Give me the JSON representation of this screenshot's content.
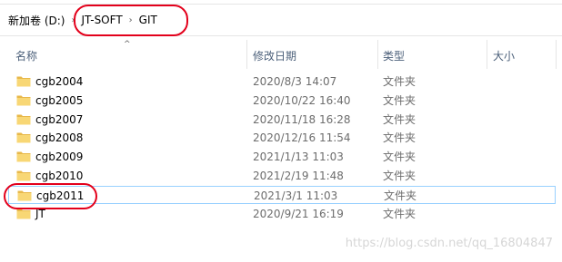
{
  "breadcrumb": {
    "items": [
      "新加卷 (D:)",
      "JT-SOFT",
      "GIT"
    ]
  },
  "columns": {
    "name": "名称",
    "date": "修改日期",
    "type": "类型",
    "size": "大小"
  },
  "files": [
    {
      "name": "cgb2004",
      "date": "2020/8/3 14:07",
      "type": "文件夹",
      "icon": "folder-icon"
    },
    {
      "name": "cgb2005",
      "date": "2020/10/22 16:40",
      "type": "文件夹",
      "icon": "folder-icon"
    },
    {
      "name": "cgb2007",
      "date": "2020/11/18 16:28",
      "type": "文件夹",
      "icon": "folder-icon"
    },
    {
      "name": "cgb2008",
      "date": "2020/12/16 11:54",
      "type": "文件夹",
      "icon": "folder-icon"
    },
    {
      "name": "cgb2009",
      "date": "2021/1/13 11:03",
      "type": "文件夹",
      "icon": "folder-icon"
    },
    {
      "name": "cgb2010",
      "date": "2021/2/19 11:48",
      "type": "文件夹",
      "icon": "folder-icon"
    },
    {
      "name": "cgb2011",
      "date": "2021/3/1 11:03",
      "type": "文件夹",
      "icon": "folder-icon",
      "selected": true
    },
    {
      "name": "JT",
      "date": "2020/9/21 16:19",
      "type": "文件夹",
      "icon": "folder-icon"
    }
  ],
  "watermark": "https://blog.csdn.net/qq_16804847",
  "colors": {
    "annotation": "#e3001b",
    "folder": "#f8d775",
    "selection_border": "#99d1ff",
    "header_text": "#4c607a"
  }
}
